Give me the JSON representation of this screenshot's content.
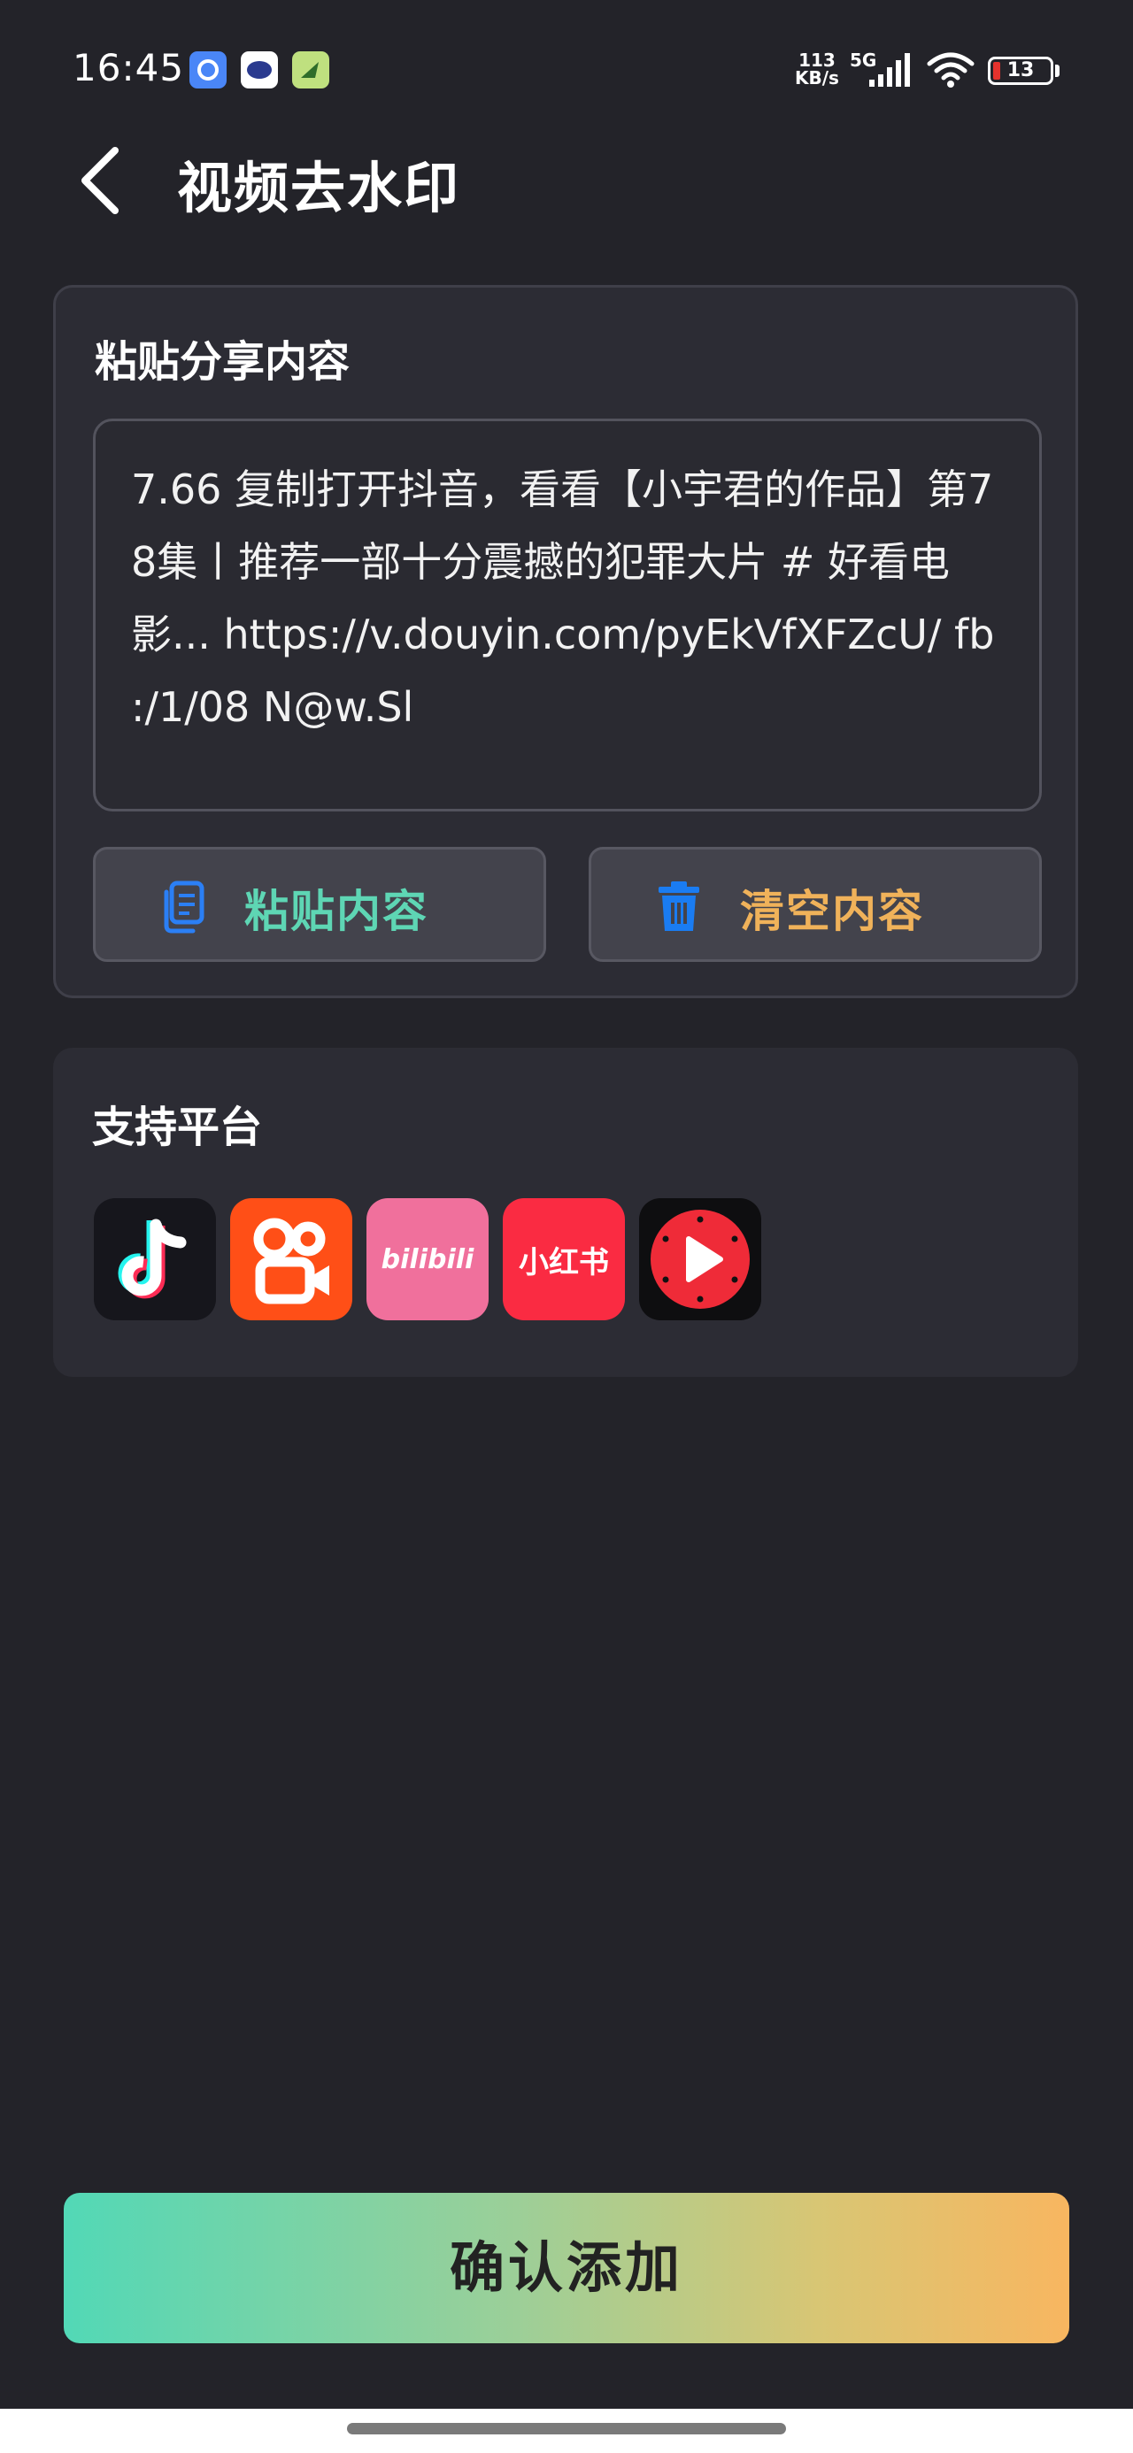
{
  "status_bar": {
    "time": "16:45",
    "net_speed_value": "113",
    "net_speed_unit": "KB/s",
    "network_type": "5G",
    "battery_level": "13",
    "icons": [
      "app-icon-blue",
      "app-icon-white",
      "app-icon-green",
      "signal-icon",
      "wifi-icon",
      "battery-icon"
    ]
  },
  "header": {
    "title": "视频去水印",
    "back_icon": "chevron-left-icon"
  },
  "paste_card": {
    "title": "粘贴分享内容",
    "share_text": "7.66 复制打开抖音，看看【小宇君的作品】第78集丨推荐一部十分震撼的犯罪大片 # 好看电影... https://v.douyin.com/pyEkVfXFZcU/ fb        :/1/08 N@w.Sl",
    "paste_button": {
      "label": "粘贴内容",
      "icon": "copy-icon",
      "color": "#5ed6b4"
    },
    "clear_button": {
      "label": "清空内容",
      "icon": "trash-icon",
      "color": "#f0b25a"
    }
  },
  "platforms_card": {
    "title": "支持平台",
    "platforms": [
      {
        "name": "douyin",
        "icon": "douyin-logo-icon"
      },
      {
        "name": "kuaishou",
        "icon": "kuaishou-logo-icon"
      },
      {
        "name": "bilibili",
        "icon": "bilibili-logo-icon",
        "logo_text": "bilibili"
      },
      {
        "name": "xiaohongshu",
        "icon": "xiaohongshu-logo-icon",
        "logo_text": "小红书"
      },
      {
        "name": "xigua",
        "icon": "xigua-logo-icon"
      }
    ]
  },
  "confirm_button": {
    "label": "确认添加"
  },
  "colors": {
    "background": "#232329",
    "card": "#2c2c34",
    "accent_green": "#52d8b6",
    "accent_orange": "#f8b660",
    "trash_blue": "#1a7cf2",
    "copy_blue": "#2b7ff5"
  }
}
